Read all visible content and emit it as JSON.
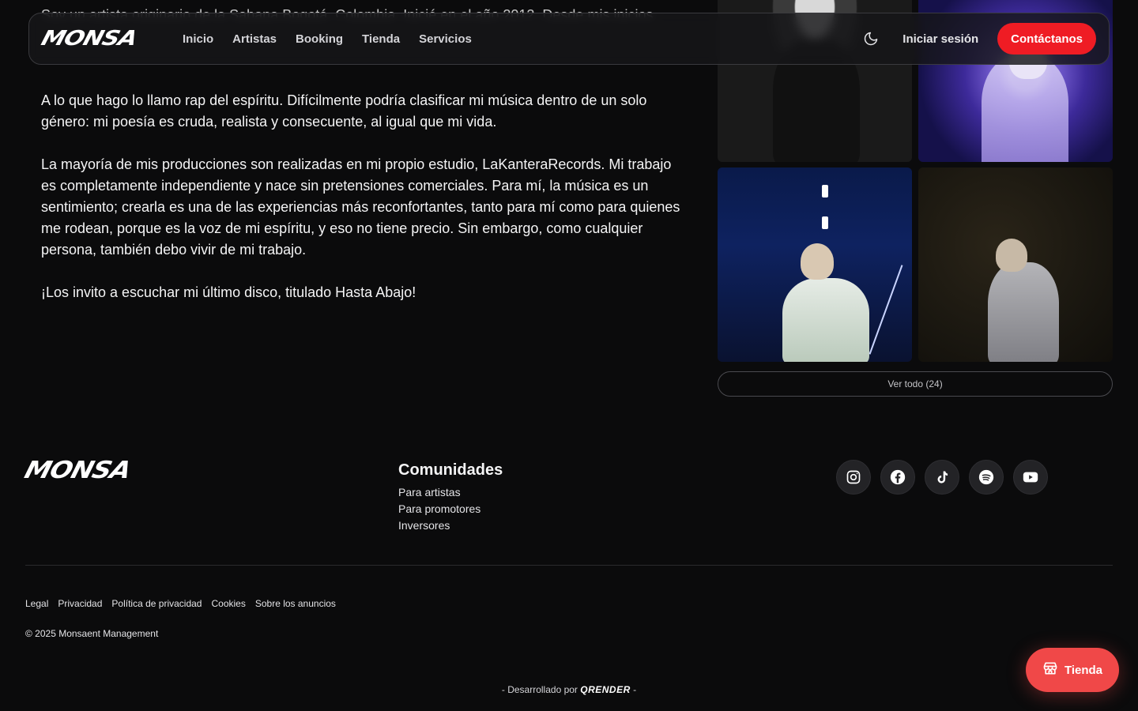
{
  "header_partial_text": "Soy un artista originario de la Sabana Bogotá, Colombia. Inicié en el año 2012. Desde mis inicios",
  "nav": {
    "logo": "MONSA",
    "links": [
      "Inicio",
      "Artistas",
      "Booking",
      "Tienda",
      "Servicios"
    ],
    "theme_icon": "moon-icon",
    "login": "Iniciar sesión",
    "contact": "Contáctanos"
  },
  "bio": {
    "paragraphs": [
      "A lo que hago lo llamo rap del espíritu. Difícilmente podría clasificar mi música dentro de un solo género: mi poesía es cruda, realista y consecuente, al igual que mi vida.",
      "La mayoría de mis producciones son realizadas en mi propio estudio, LaKanteraRecords. Mi trabajo es completamente independiente y nace sin pretensiones comerciales. Para mí, la música es un sentimiento; crearla es una de las experiencias más reconfortantes, tanto para mí como para quienes me rodean, porque es la voz de mi espíritu, y eso no tiene precio. Sin embargo, como cualquier persona, también debo vivir de mi trabajo.",
      "¡Los invito a escuchar mi último disco, titulado Hasta Abajo!"
    ]
  },
  "gallery": {
    "view_all": "Ver todo (24)"
  },
  "footer": {
    "logo": "MONSA",
    "communities": {
      "title": "Comunidades",
      "links": [
        "Para artistas",
        "Para promotores",
        "Inversores"
      ]
    },
    "socials": [
      "instagram-icon",
      "facebook-icon",
      "tiktok-icon",
      "spotify-icon",
      "youtube-icon"
    ],
    "legal_links": [
      "Legal",
      "Privacidad",
      "Política de privacidad",
      "Cookies",
      "Sobre los anuncios"
    ],
    "copyright": "© 2025 Monsaent Management",
    "dev_prefix": "- Desarrollado por",
    "dev_brand": "QRENDER",
    "dev_suffix": "-"
  },
  "store_fab": {
    "label": "Tienda",
    "icon": "store-icon"
  },
  "colors": {
    "accent": "#ef1c24",
    "fab": "#f04848",
    "background": "#0b0b0c"
  }
}
